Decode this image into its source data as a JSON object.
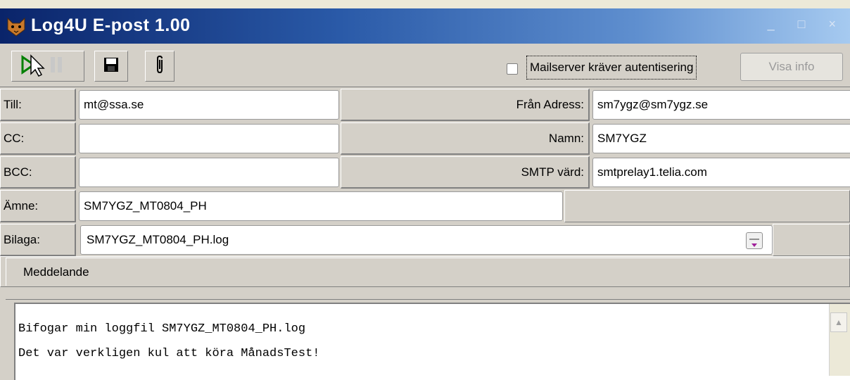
{
  "window": {
    "title": "Log4U E-post 1.00"
  },
  "toolbar": {
    "auth_checkbox_label": "Mailserver kräver autentisering",
    "auth_checked": false,
    "info_button_label": "Visa info"
  },
  "fields": {
    "to_label": "Till:",
    "to_value": "mt@ssa.se",
    "cc_label": "CC:",
    "cc_value": "",
    "bcc_label": "BCC:",
    "bcc_value": "",
    "from_address_label": "Från Adress:",
    "from_address_value": "sm7ygz@sm7ygz.se",
    "name_label": "Namn:",
    "name_value": "SM7YGZ",
    "smtp_label": "SMTP värd:",
    "smtp_value": "smtprelay1.telia.com",
    "subject_label": "Ämne:",
    "subject_value": "SM7YGZ_MT0804_PH",
    "attachment_label": "Bilaga:",
    "attachment_value": "SM7YGZ_MT0804_PH.log"
  },
  "message": {
    "tab_label": "Meddelande",
    "line1": "Bifogar min loggfil SM7YGZ_MT0804_PH.log",
    "line2": "Det var verkligen kul att köra MånadsTest!"
  },
  "icons": {
    "app": "cat-face-icon",
    "send": "send-cursor-icon",
    "save": "floppy-disk-icon",
    "attach": "paperclip-icon",
    "browse": "browse-folder-icon",
    "scroll_up": "scroll-up-arrow-icon"
  },
  "colors": {
    "titlebar_start": "#0a246a",
    "titlebar_end": "#a6caf0",
    "face": "#d4d0c8",
    "send_icon": "#008000"
  }
}
